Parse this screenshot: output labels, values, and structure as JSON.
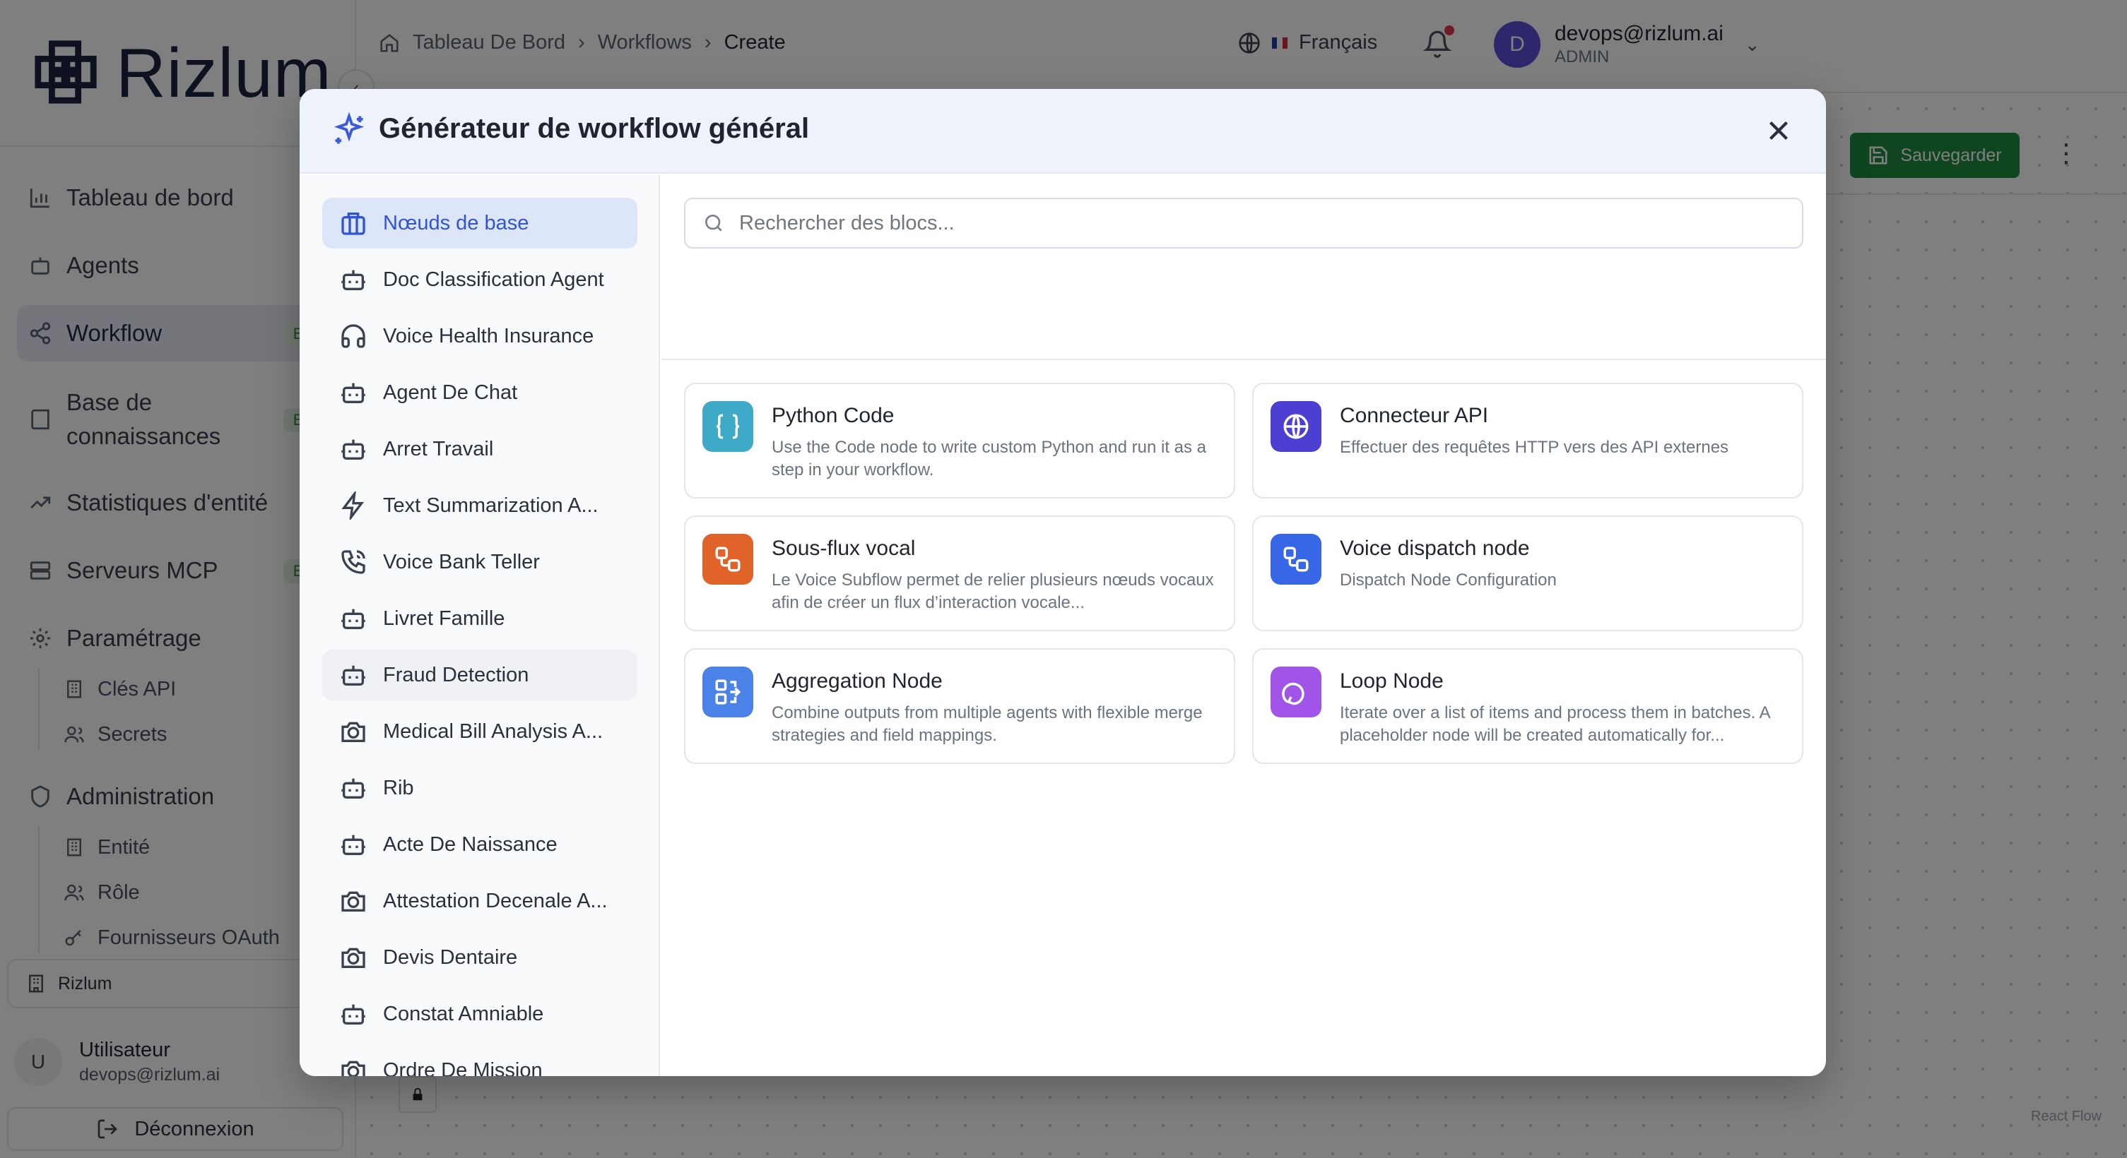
{
  "app": {
    "brand": "Rizlum"
  },
  "sidebar": {
    "items": [
      {
        "label": "Tableau de bord",
        "badge": ""
      },
      {
        "label": "Agents",
        "badge": ""
      },
      {
        "label": "Workflow",
        "badge": "Beta"
      },
      {
        "label": "Base de connaissances",
        "badge": "Beta"
      },
      {
        "label": "Statistiques d'entité",
        "badge": ""
      },
      {
        "label": "Serveurs MCP",
        "badge": "Beta"
      },
      {
        "label": "Paramétrage",
        "badge": ""
      },
      {
        "label": "Administration",
        "badge": ""
      }
    ],
    "parametrage_sub": [
      "Clés API",
      "Secrets"
    ],
    "admin_sub": [
      "Entité",
      "Rôle",
      "Fournisseurs OAuth"
    ],
    "org": "Rizlum",
    "user": {
      "initial": "U",
      "name": "Utilisateur",
      "email": "devops@rizlum.ai"
    },
    "logout": "Déconnexion"
  },
  "header": {
    "breadcrumb": [
      "Tableau De Bord",
      "Workflows",
      "Create"
    ],
    "language": "Français",
    "account": {
      "initial": "D",
      "email": "devops@rizlum.ai",
      "role": "ADMIN"
    }
  },
  "toolbar": {
    "save_label": "Sauvegarder"
  },
  "canvas": {
    "attribution": "React Flow"
  },
  "modal": {
    "title": "Générateur de workflow général",
    "search_placeholder": "Rechercher des blocs...",
    "categories": [
      {
        "label": "Nœuds de base",
        "icon": "building-icon"
      },
      {
        "label": "Doc Classification Agent",
        "icon": "bot-icon"
      },
      {
        "label": "Voice Health Insurance",
        "icon": "headphones-icon"
      },
      {
        "label": "Agent De Chat",
        "icon": "bot-icon"
      },
      {
        "label": "Arret Travail",
        "icon": "bot-icon"
      },
      {
        "label": "Text Summarization A...",
        "icon": "zap-icon"
      },
      {
        "label": "Voice Bank Teller",
        "icon": "phone-icon"
      },
      {
        "label": "Livret Famille",
        "icon": "bot-icon"
      },
      {
        "label": "Fraud Detection",
        "icon": "bot-icon"
      },
      {
        "label": "Medical Bill Analysis A...",
        "icon": "camera-icon"
      },
      {
        "label": "Rib",
        "icon": "bot-icon"
      },
      {
        "label": "Acte De Naissance",
        "icon": "bot-icon"
      },
      {
        "label": "Attestation Decenale A...",
        "icon": "camera-icon"
      },
      {
        "label": "Devis Dentaire",
        "icon": "camera-icon"
      },
      {
        "label": "Constat Amniable",
        "icon": "bot-icon"
      },
      {
        "label": "Ordre De Mission",
        "icon": "camera-icon"
      }
    ],
    "blocks": [
      {
        "title": "Python Code",
        "desc": "Use the Code node to write custom Python and run it as a step in your workflow.",
        "icon": "code-braces-icon",
        "color": "#3fa9c8"
      },
      {
        "title": "Connecteur API",
        "desc": "Effectuer des requêtes HTTP vers des API externes",
        "icon": "globe-icon",
        "color": "#4c3fd1"
      },
      {
        "title": "Sous-flux vocal",
        "desc": "Le Voice Subflow permet de relier plusieurs nœuds vocaux afin de créer un flux d’interaction vocale...",
        "icon": "workflow-icon",
        "color": "#e0642a"
      },
      {
        "title": "Voice dispatch node",
        "desc": "Dispatch Node Configuration",
        "icon": "workflow-icon",
        "color": "#3766e6"
      },
      {
        "title": "Aggregation Node",
        "desc": "Combine outputs from multiple agents with flexible merge strategies and field mappings.",
        "icon": "merge-icon",
        "color": "#4a82e8"
      },
      {
        "title": "Loop Node",
        "desc": "Iterate over a list of items and process them in batches. A placeholder node will be created automatically for...",
        "icon": "loop-icon",
        "color": "#a055e8"
      }
    ]
  }
}
